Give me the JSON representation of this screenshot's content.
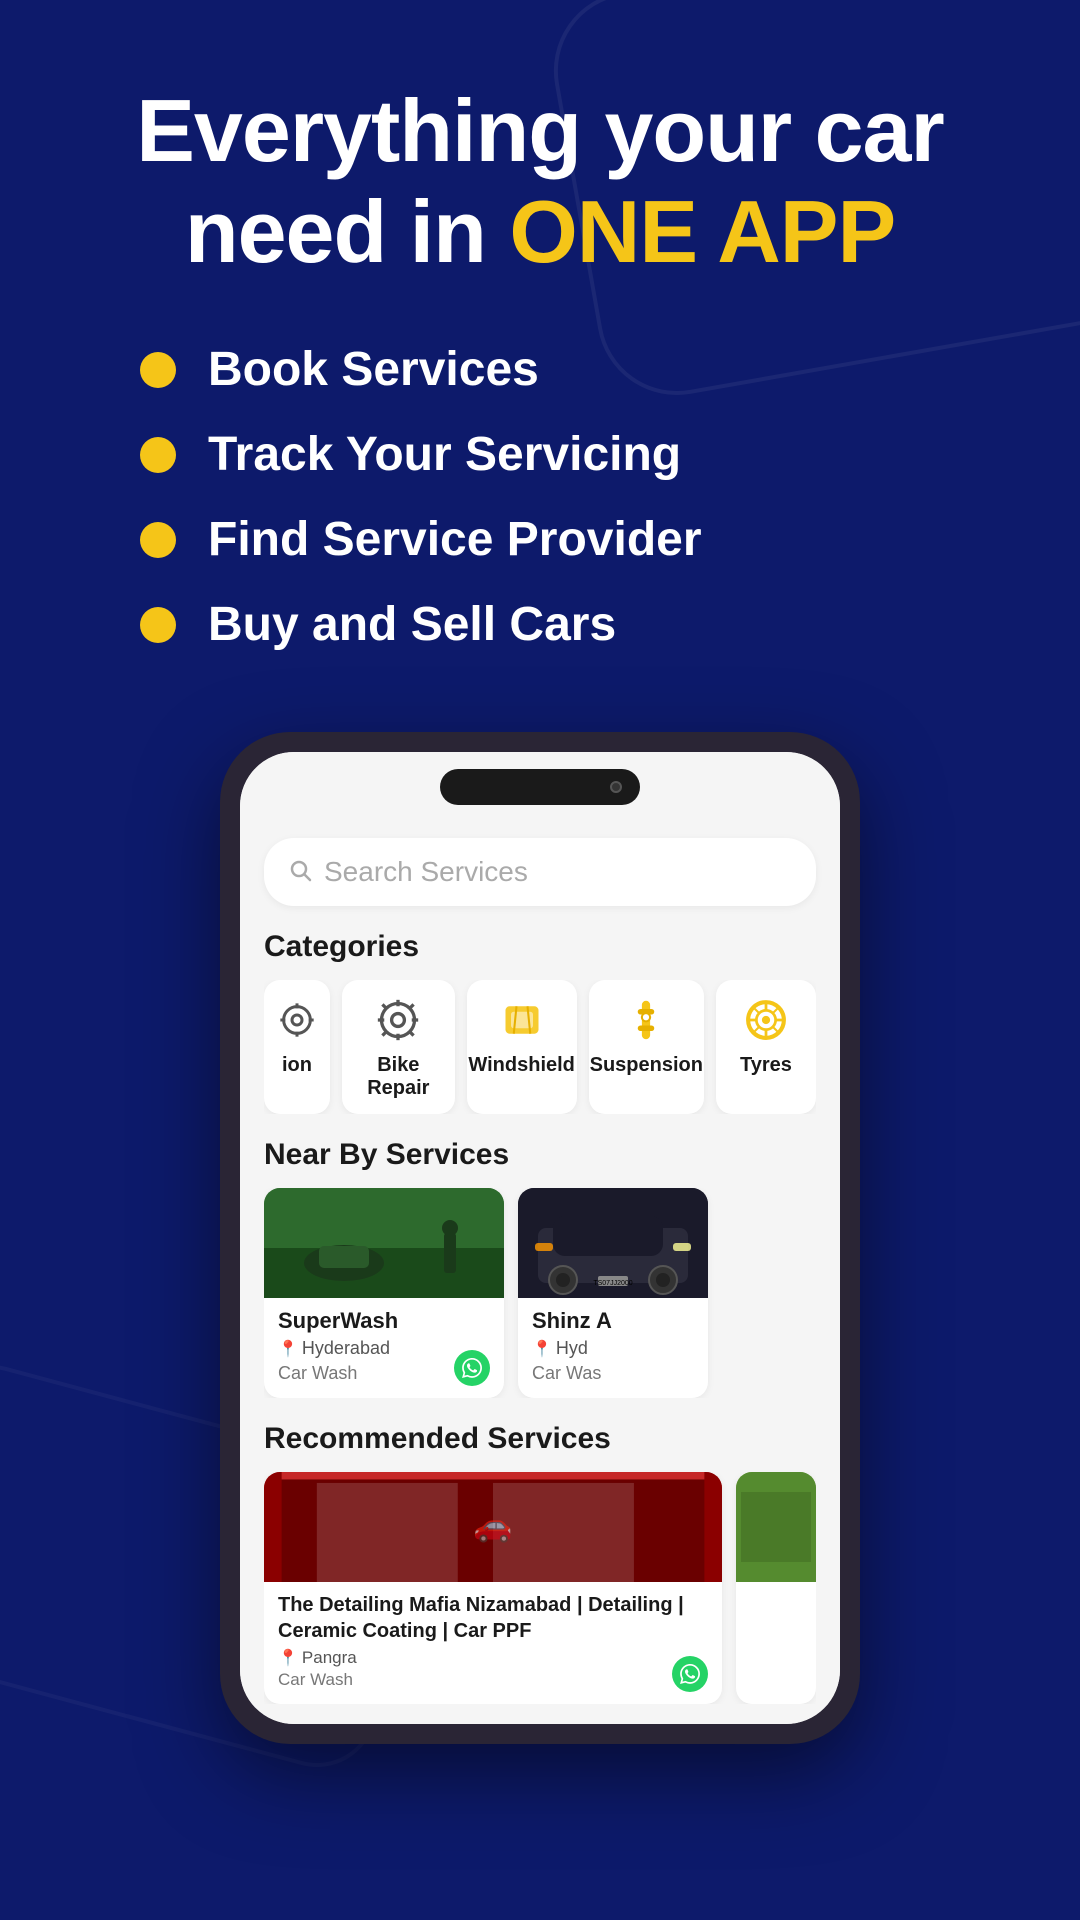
{
  "hero": {
    "heading_white": "Everything your car",
    "heading_white2": "need in ",
    "heading_highlight": "ONE APP"
  },
  "features": [
    {
      "text": "Book Services"
    },
    {
      "text": "Track Your Servicing"
    },
    {
      "text": "Find Service Provider"
    },
    {
      "text": "Buy and Sell Cars"
    }
  ],
  "app": {
    "search": {
      "placeholder": "Search Services"
    },
    "categories": {
      "title": "Categories",
      "items": [
        {
          "label": "ion",
          "icon": "partial"
        },
        {
          "label": "Bike Repair",
          "icon": "gear"
        },
        {
          "label": "Windshield",
          "icon": "windshield"
        },
        {
          "label": "Suspension",
          "icon": "suspension"
        },
        {
          "label": "Tyres",
          "icon": "tyre"
        }
      ]
    },
    "nearby": {
      "title": "Near By Services",
      "items": [
        {
          "name": "SuperWash",
          "city": "Hyderabad",
          "type": "Car Wash",
          "img": "superwash"
        },
        {
          "name": "Shinz A",
          "city": "Hyd",
          "type": "Car Was",
          "img": "shinz"
        }
      ]
    },
    "recommended": {
      "title": "Recommended Services",
      "items": [
        {
          "name": "The Detailing Mafia Nizamabad | Detailing | Ceramic Coating | Car PPF",
          "city": "Pangra",
          "type": "Car Wash",
          "img": "detailing"
        },
        {
          "name": "",
          "city": "",
          "type": "",
          "img": "partial2"
        }
      ]
    }
  },
  "whatsapp_label": "💬",
  "colors": {
    "bg": "#0d1a6b",
    "highlight": "#f5c518",
    "white": "#ffffff"
  }
}
